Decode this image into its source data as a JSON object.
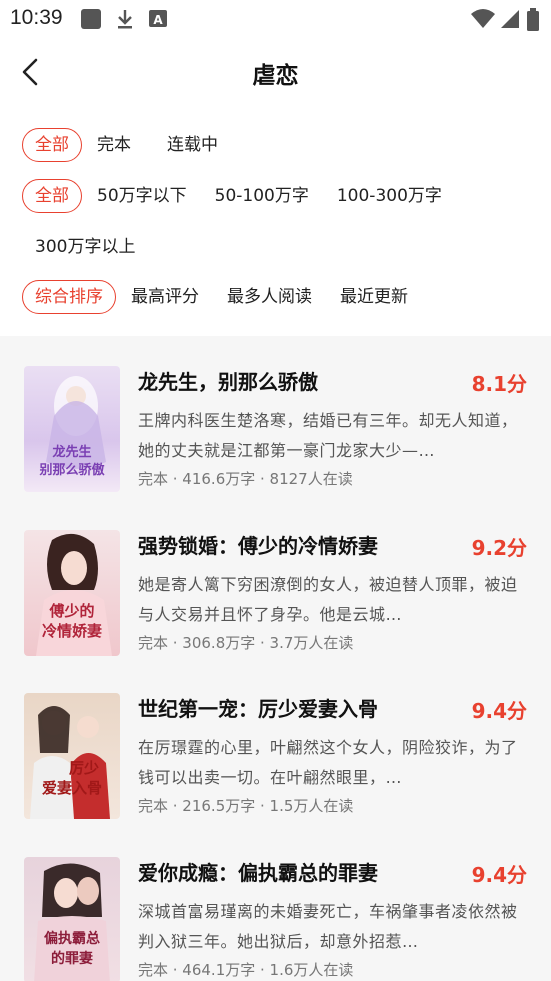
{
  "status": {
    "time": "10:39",
    "icons": [
      "gallery-icon",
      "download-icon",
      "font-icon",
      "wifi-icon",
      "signal-icon",
      "battery-icon"
    ]
  },
  "header": {
    "title": "虐恋",
    "back_icon": "chevron-left-icon"
  },
  "filters": {
    "status": [
      "全部",
      "完本",
      "连载中"
    ],
    "length": [
      "全部",
      "50万字以下",
      "50-100万字",
      "100-300万字",
      "300万字以上"
    ],
    "sort": [
      "综合排序",
      "最高评分",
      "最多人阅读",
      "最近更新"
    ],
    "accent_color": "#e8412f"
  },
  "books": [
    {
      "title": "龙先生，别那么骄傲",
      "score": "8.1分",
      "desc": "王牌内科医生楚洛寒，结婚已有三年。却无人知道，她的丈夫就是江都第一豪门龙家大少—…",
      "meta": "完本 · 416.6万字 · 8127人在读",
      "cover_text": [
        "龙先生",
        "别那么骄傲"
      ]
    },
    {
      "title": "强势锁婚：傅少的冷情娇妻",
      "score": "9.2分",
      "desc": "她是寄人篱下穷困潦倒的女人，被迫替人顶罪，被迫与人交易并且怀了身孕。他是云城…",
      "meta": "完本 · 306.8万字 · 3.7万人在读",
      "cover_text": [
        "傅少的",
        "冷情娇妻"
      ]
    },
    {
      "title": "世纪第一宠：厉少爱妻入骨",
      "score": "9.4分",
      "desc": "在厉璟霆的心里，叶翩然这个女人，阴险狡诈，为了钱可以出卖一切。在叶翩然眼里，…",
      "meta": "完本 · 216.5万字 · 1.5万人在读",
      "cover_text": [
        "厉少",
        "爱妻入骨"
      ]
    },
    {
      "title": "爱你成瘾：偏执霸总的罪妻",
      "score": "9.4分",
      "desc": "深城首富易瑾离的未婚妻死亡，车祸肇事者凌依然被判入狱三年。她出狱后，却意外招惹…",
      "meta": "完本 · 464.1万字 · 1.6万人在读",
      "cover_text": [
        "偏执霸总",
        "的罪妻"
      ]
    }
  ]
}
